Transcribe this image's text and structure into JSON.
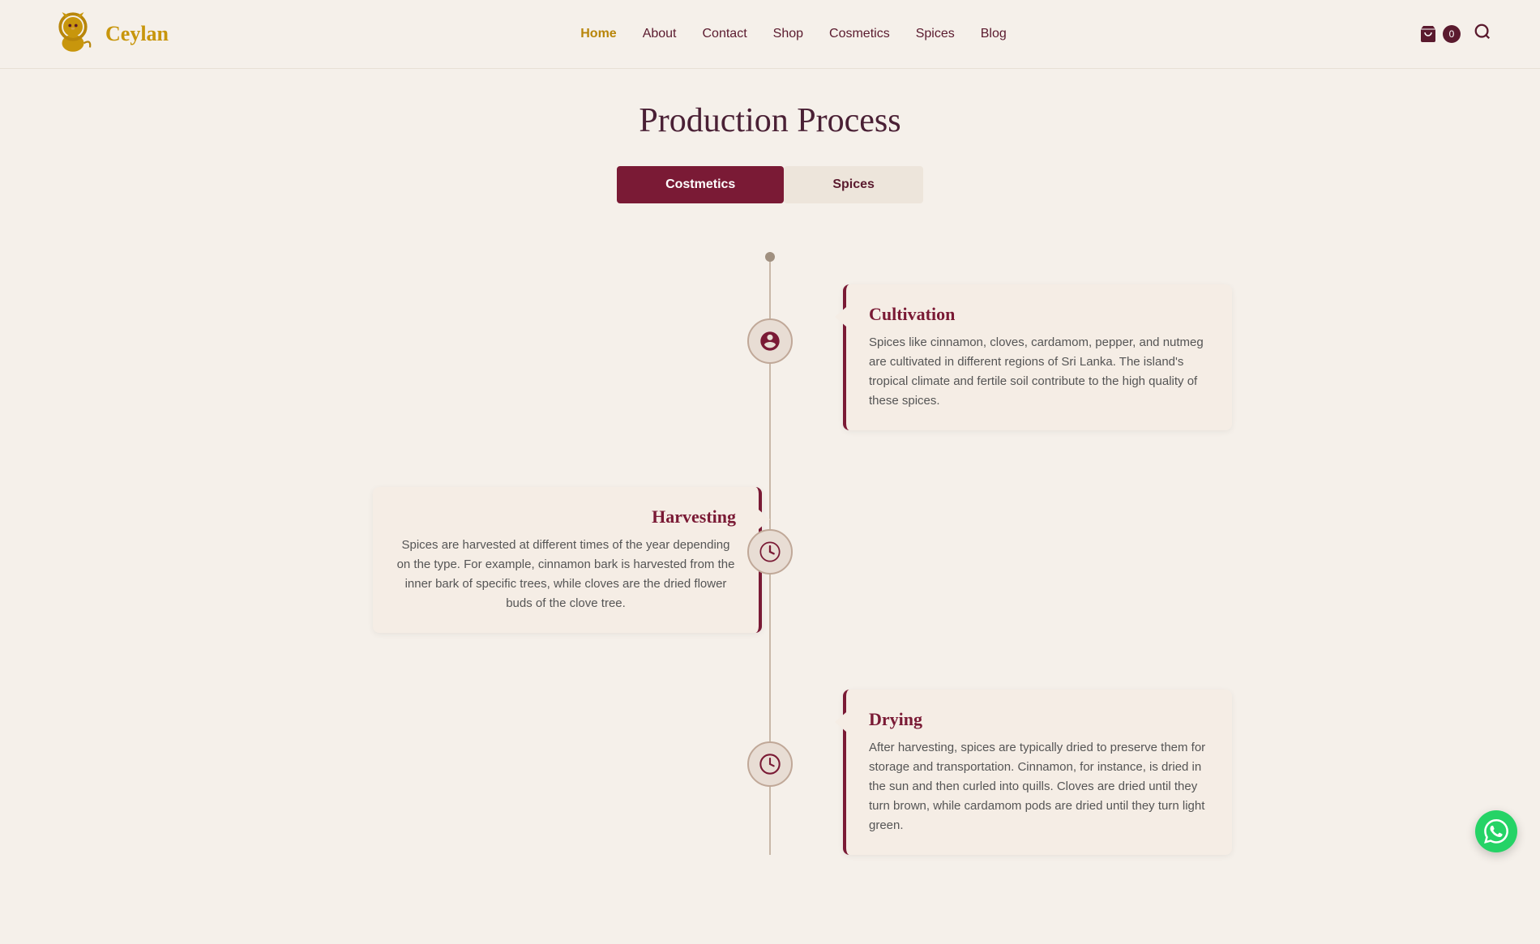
{
  "header": {
    "logo_text": "Ceylan",
    "nav_items": [
      {
        "label": "Home",
        "active": true
      },
      {
        "label": "About",
        "active": false
      },
      {
        "label": "Contact",
        "active": false
      },
      {
        "label": "Shop",
        "active": false
      },
      {
        "label": "Cosmetics",
        "active": false
      },
      {
        "label": "Spices",
        "active": false
      },
      {
        "label": "Blog",
        "active": false
      }
    ],
    "cart_count": "0"
  },
  "page": {
    "title": "Production Process",
    "tabs": [
      {
        "label": "Costmetics",
        "active": true
      },
      {
        "label": "Spices",
        "active": false
      }
    ]
  },
  "timeline": {
    "steps": [
      {
        "id": "cultivation",
        "icon": "plant",
        "title": "Cultivation",
        "text": "Spices like cinnamon, cloves, cardamom, pepper, and nutmeg are cultivated in different regions of Sri Lanka. The island's tropical climate and fertile soil contribute to the high quality of these spices.",
        "side": "right"
      },
      {
        "id": "harvesting",
        "icon": "clock",
        "title": "Harvesting",
        "text": "Spices are harvested at different times of the year depending on the type. For example, cinnamon bark is harvested from the inner bark of specific trees, while cloves are the dried flower buds of the clove tree.",
        "side": "left"
      },
      {
        "id": "drying",
        "icon": "clock",
        "title": "Drying",
        "text": "After harvesting, spices are typically dried to preserve them for storage and transportation. Cinnamon, for instance, is dried in the sun and then curled into quills. Cloves are dried until they turn brown, while cardamom pods are dried until they turn light green.",
        "side": "right"
      }
    ]
  }
}
